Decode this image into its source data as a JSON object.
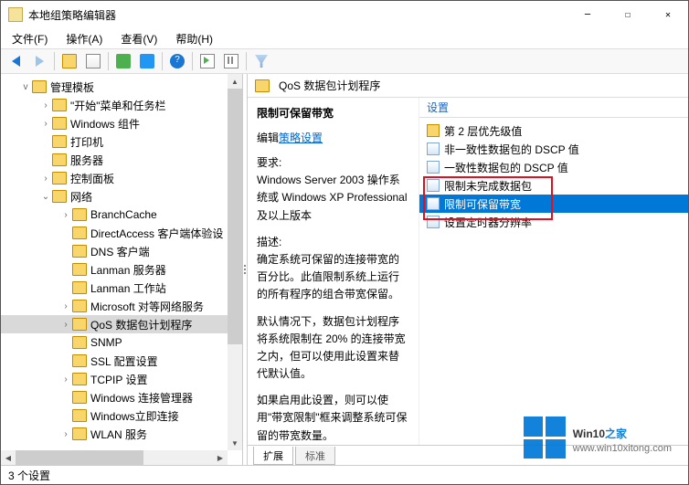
{
  "window": {
    "title": "本地组策略编辑器"
  },
  "menubar": [
    {
      "label": "文件(F)"
    },
    {
      "label": "操作(A)"
    },
    {
      "label": "查看(V)"
    },
    {
      "label": "帮助(H)"
    }
  ],
  "tree": {
    "root": "管理模板",
    "items": [
      {
        "level": 1,
        "exp": ">",
        "label": "\"开始\"菜单和任务栏"
      },
      {
        "level": 1,
        "exp": ">",
        "label": "Windows 组件"
      },
      {
        "level": 1,
        "exp": "",
        "label": "打印机"
      },
      {
        "level": 1,
        "exp": "",
        "label": "服务器"
      },
      {
        "level": 1,
        "exp": ">",
        "label": "控制面板"
      },
      {
        "level": 1,
        "exp": "v",
        "label": "网络"
      },
      {
        "level": 2,
        "exp": ">",
        "label": "BranchCache"
      },
      {
        "level": 2,
        "exp": "",
        "label": "DirectAccess 客户端体验设"
      },
      {
        "level": 2,
        "exp": "",
        "label": "DNS 客户端"
      },
      {
        "level": 2,
        "exp": "",
        "label": "Lanman 服务器"
      },
      {
        "level": 2,
        "exp": "",
        "label": "Lanman 工作站"
      },
      {
        "level": 2,
        "exp": ">",
        "label": "Microsoft 对等网络服务"
      },
      {
        "level": 2,
        "exp": ">",
        "label": "QoS 数据包计划程序",
        "selected": true
      },
      {
        "level": 2,
        "exp": "",
        "label": "SNMP"
      },
      {
        "level": 2,
        "exp": "",
        "label": "SSL 配置设置"
      },
      {
        "level": 2,
        "exp": ">",
        "label": "TCPIP 设置"
      },
      {
        "level": 2,
        "exp": "",
        "label": "Windows 连接管理器"
      },
      {
        "level": 2,
        "exp": "",
        "label": "Windows立即连接"
      },
      {
        "level": 2,
        "exp": ">",
        "label": "WLAN 服务"
      }
    ]
  },
  "right": {
    "header": "QoS 数据包计划程序",
    "detail": {
      "title": "限制可保留带宽",
      "edit_prefix": "编辑",
      "edit_link": "策略设置",
      "req_label": "要求:",
      "req_text": "Windows Server 2003 操作系统或 Windows XP Professional 及以上版本",
      "desc_label": "描述:",
      "desc_text": "确定系统可保留的连接带宽的百分比。此值限制系统上运行的所有程序的组合带宽保留。",
      "para1": "默认情况下，数据包计划程序将系统限制在 20% 的连接带宽之内，但可以使用此设置来替代默认值。",
      "para2": "如果启用此设置，则可以使用\"带宽限制\"框来调整系统可保留的带宽数量。"
    },
    "settings_header": "设置",
    "settings": [
      {
        "icon": "folder",
        "label": "第 2 层优先级值"
      },
      {
        "icon": "sheet",
        "label": "非一致性数据包的 DSCP 值"
      },
      {
        "icon": "sheet",
        "label": "一致性数据包的 DSCP 值"
      },
      {
        "icon": "sheet",
        "label": "限制未完成数据包"
      },
      {
        "icon": "sheet",
        "label": "限制可保留带宽",
        "selected": true
      },
      {
        "icon": "sheet",
        "label": "设置定时器分辨率"
      }
    ],
    "tabs": {
      "extended": "扩展",
      "standard": "标准"
    }
  },
  "status": "3 个设置",
  "watermark": {
    "brand_a": "Win10",
    "brand_b": "之家",
    "url": "www.win10xitong.com"
  }
}
